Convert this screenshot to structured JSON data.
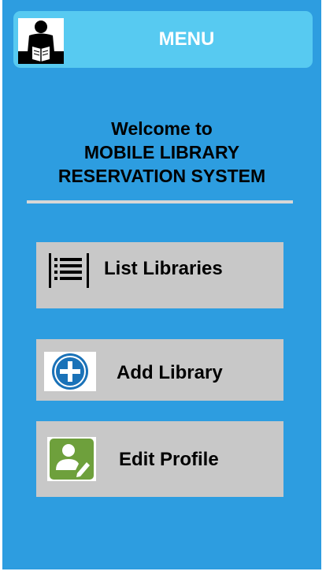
{
  "header": {
    "menu_label": "MENU",
    "logo_icon": "reader-with-book-icon"
  },
  "welcome": {
    "line1": "Welcome to",
    "line2": "MOBILE LIBRARY",
    "line3": "RESERVATION SYSTEM"
  },
  "buttons": {
    "list_libraries": {
      "label": "List Libraries",
      "icon": "list-icon"
    },
    "add_library": {
      "label": "Add Library",
      "icon": "plus-circle-icon"
    },
    "edit_profile": {
      "label": "Edit Profile",
      "icon": "user-edit-icon"
    }
  },
  "colors": {
    "background": "#2d9de0",
    "menu_bar": "#57caf1",
    "button": "#c8c8c8",
    "add_icon": "#1a72b8",
    "edit_icon": "#6ea03c"
  }
}
